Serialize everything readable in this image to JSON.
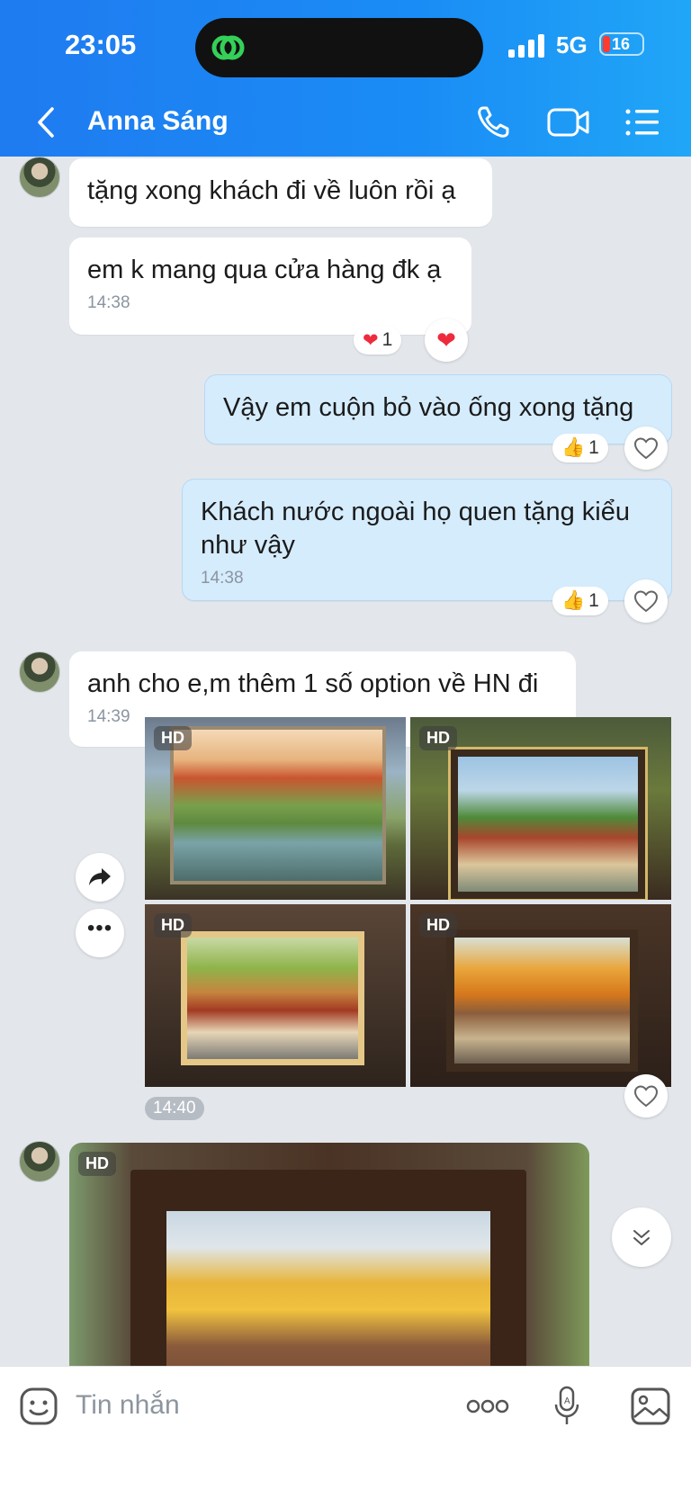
{
  "status": {
    "time": "23:05",
    "network": "5G",
    "battery": "16"
  },
  "header": {
    "contact_name": "Anna Sáng"
  },
  "messages": {
    "m1": {
      "text": "tặng xong khách đi về luôn rồi ạ"
    },
    "m2": {
      "text": "em k mang qua cửa hàng đk ạ",
      "time": "14:38",
      "reaction_count": "1"
    },
    "m3": {
      "text": "Vậy em cuộn bỏ vào ống xong tặng",
      "reaction_count": "1"
    },
    "m4": {
      "text": "Khách nước ngoài họ quen tặng kiểu như vậy",
      "time": "14:38",
      "reaction_count": "1"
    },
    "m5": {
      "text": "anh cho e,m thêm 1 số option về HN đi",
      "time": "14:39"
    },
    "gallery": {
      "time": "14:40",
      "badge": "HD"
    },
    "last_photo": {
      "badge": "HD"
    }
  },
  "input": {
    "placeholder": "Tin nhắn"
  },
  "colors": {
    "header": "#1a8cf5",
    "outgoing_bubble": "#d5ecfd",
    "background": "#e3e7ec"
  }
}
